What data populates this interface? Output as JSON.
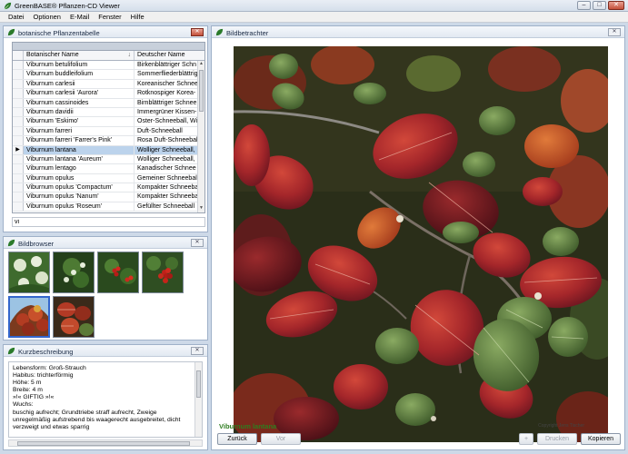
{
  "window": {
    "title": "GreenBASE® Pflanzen-CD Viewer"
  },
  "menu": [
    "Datei",
    "Optionen",
    "E-Mail",
    "Fenster",
    "Hilfe"
  ],
  "table_panel": {
    "title": "botanische Pflanzentabelle",
    "columns": [
      "Botanischer Name",
      "Deutscher Name"
    ],
    "rows": [
      [
        "Viburnum betulifolium",
        "Birkenblättriger Schn"
      ],
      [
        "Viburnum buddleifolium",
        "Sommerfliederblättrig"
      ],
      [
        "Viburnum carlesii",
        "Koreanischer Schnee"
      ],
      [
        "Viburnum carlesii 'Aurora'",
        "Rotknospiger Korea-"
      ],
      [
        "Viburnum cassinoides",
        "Birnblättriger Schnee"
      ],
      [
        "Viburnum davidii",
        "Immergrüner Kissen-"
      ],
      [
        "Viburnum 'Eskimo'",
        "Oster-Schneeball, Wi"
      ],
      [
        "Viburnum farreri",
        "Duft-Schneeball"
      ],
      [
        "Viburnum farreri 'Farrer's Pink'",
        "Rosa Duft-Schneeball"
      ],
      [
        "Viburnum lantana",
        "Wolliger Schneeball,"
      ],
      [
        "Viburnum lantana 'Aureum'",
        "Wolliger Schneeball,"
      ],
      [
        "Viburnum lentago",
        "Kanadischer Schnee"
      ],
      [
        "Viburnum opulus",
        "Gemeiner Schneeball"
      ],
      [
        "Viburnum opulus 'Compactum'",
        "Kompakter Schneeba"
      ],
      [
        "Viburnum opulus 'Nanum'",
        "Kompakter Schneeba"
      ],
      [
        "Viburnum opulus 'Roseum'",
        "Gefüllter Schneeball"
      ]
    ],
    "selected_index": 9,
    "filter_value": "vi"
  },
  "browser_panel": {
    "title": "Bildbrowser"
  },
  "desc_panel": {
    "title": "Kurzbeschreibung",
    "lines": [
      "Lebensform: Groß-Strauch",
      "Habitus: trichterförmig",
      "Höhe: 5 m",
      "Breite: 4 m",
      "»!« GIFTIG »!«",
      "Wuchs:",
      "buschig aufrecht; Grundtriebe straff aufrecht, Zweige",
      "unregelmäßig aufstrebend bis waagerecht ausgebreitet, dicht",
      "verzweigt und etwas sparrig"
    ]
  },
  "viewer_panel": {
    "title": "Bildbetrachter",
    "plant_name": "Viburnum lantana",
    "copyright": "Copyright Jens Tischer",
    "buttons": {
      "back": "Zurück",
      "forward": "Vor",
      "plus": "+",
      "print": "Drucken",
      "copy": "Kopieren"
    }
  },
  "colors": {
    "accent": "#3366cc",
    "plant_name": "#2e7d1f",
    "selection": "#bcd3ec"
  }
}
